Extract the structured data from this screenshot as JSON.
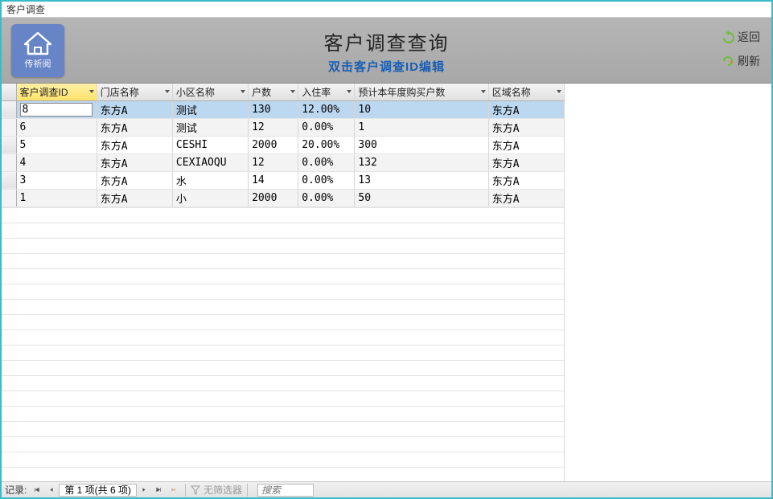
{
  "window": {
    "title": "客户调查"
  },
  "logo": {
    "text": "传祈阅"
  },
  "header": {
    "title": "客户调查查询",
    "subtitle": "双击客户调查ID编辑"
  },
  "actions": {
    "back": "返回",
    "refresh": "刷新"
  },
  "columns": [
    "客户调查ID",
    "门店名称",
    "小区名称",
    "户数",
    "入住率",
    "预计本年度购买户数",
    "区域名称"
  ],
  "rows": [
    {
      "id": "8",
      "store": "东方A",
      "community": "测试",
      "households": "130",
      "occupancy": "12.00%",
      "buyers": "10",
      "region": "东方A",
      "selected": true,
      "editing": true
    },
    {
      "id": "6",
      "store": "东方A",
      "community": "测试",
      "households": "12",
      "occupancy": "0.00%",
      "buyers": "1",
      "region": "东方A"
    },
    {
      "id": "5",
      "store": "东方A",
      "community": "CESHI",
      "households": "2000",
      "occupancy": "20.00%",
      "buyers": "300",
      "region": "东方A"
    },
    {
      "id": "4",
      "store": "东方A",
      "community": "CEXIAOQU",
      "households": "12",
      "occupancy": "0.00%",
      "buyers": "132",
      "region": "东方A"
    },
    {
      "id": "3",
      "store": "东方A",
      "community": "水",
      "households": "14",
      "occupancy": "0.00%",
      "buyers": "13",
      "region": "东方A"
    },
    {
      "id": "1",
      "store": "东方A",
      "community": "小",
      "households": "2000",
      "occupancy": "0.00%",
      "buyers": "50",
      "region": "东方A"
    }
  ],
  "footer": {
    "record_label": "记录:",
    "position": "第 1 项(共 6 项)",
    "no_filter": "无筛选器",
    "search_placeholder": "搜索"
  }
}
